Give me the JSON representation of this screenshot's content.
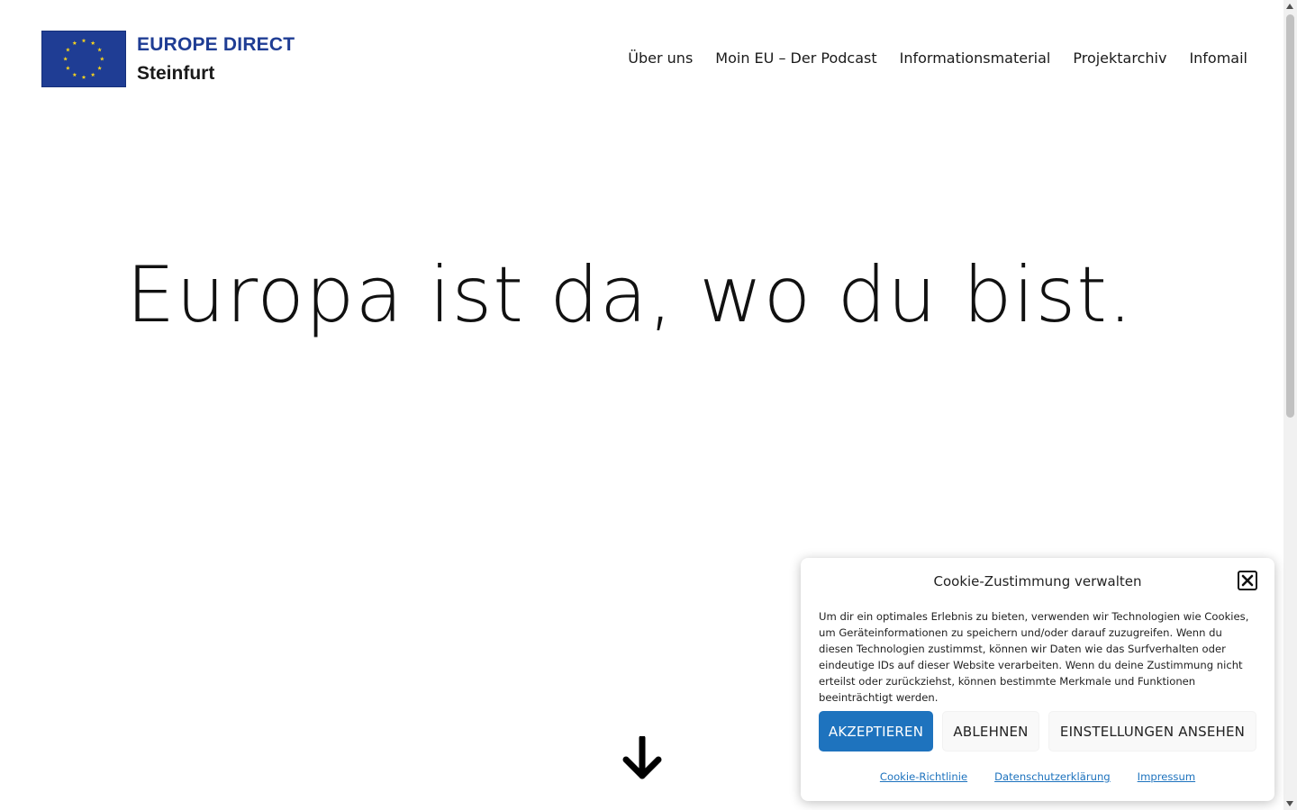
{
  "header": {
    "logo": {
      "line1": "EUROPE DIRECT",
      "line2": "Steinfurt"
    },
    "nav": [
      {
        "label": "Über uns"
      },
      {
        "label": "Moin EU – Der Podcast"
      },
      {
        "label": "Informationsmaterial"
      },
      {
        "label": "Projektarchiv"
      },
      {
        "label": "Infomail"
      }
    ]
  },
  "hero": {
    "title": "Europa ist da, wo du bist.",
    "scroll_icon": "arrow-down-icon"
  },
  "cookie": {
    "title": "Cookie-Zustimmung verwalten",
    "close_icon": "close-icon",
    "body": "Um dir ein optimales Erlebnis zu bieten, verwenden wir Technologien wie Cookies, um Geräteinformationen zu speichern und/oder darauf zuzugreifen. Wenn du diesen Technologien zustimmst, können wir Daten wie das Surfverhalten oder eindeutige IDs auf dieser Website verarbeiten. Wenn du deine Zustimmung nicht erteilst oder zurückziehst, können bestimmte Merkmale und Funktionen beeinträchtigt werden.",
    "buttons": {
      "accept": "AKZEPTIEREN",
      "deny": "ABLEHNEN",
      "preferences": "EINSTELLUNGEN ANSEHEN"
    },
    "links": [
      {
        "label": "Cookie-Richtlinie"
      },
      {
        "label": "Datenschutzerklärung"
      },
      {
        "label": "Impressum"
      }
    ]
  },
  "colors": {
    "eu_blue": "#1f3d94",
    "eu_star": "#f5d21e",
    "accent": "#1e73be"
  }
}
